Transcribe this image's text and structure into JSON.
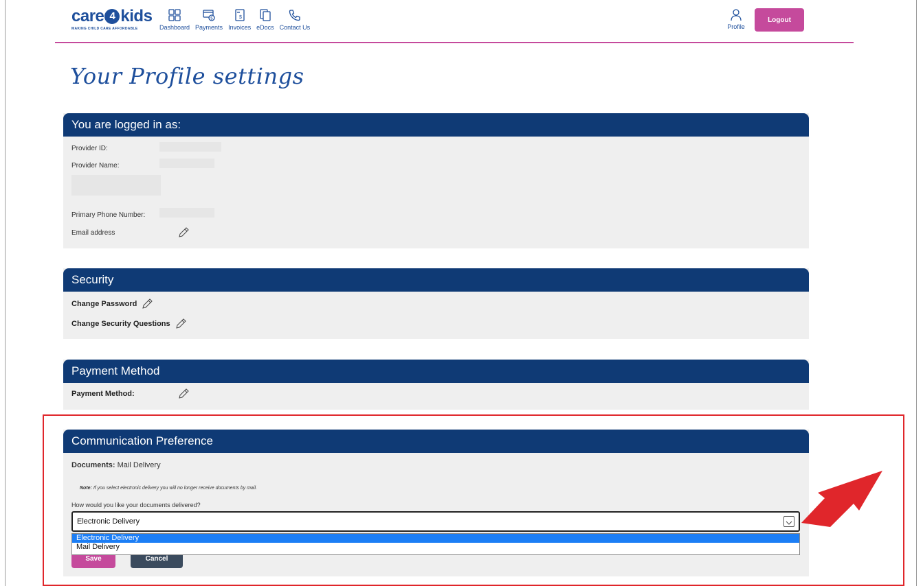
{
  "brand": {
    "name_left": "care",
    "name_mid": "4",
    "name_right": "kids",
    "tagline": "MAKING CHILD CARE AFFORDABLE",
    "primary_color": "#1e4f9c",
    "accent_color": "#c54a9c"
  },
  "nav": [
    {
      "label": "Dashboard",
      "icon": "dashboard-icon"
    },
    {
      "label": "Payments",
      "icon": "payments-icon"
    },
    {
      "label": "Invoices",
      "icon": "invoices-icon"
    },
    {
      "label": "eDocs",
      "icon": "edocs-icon"
    },
    {
      "label": "Contact Us",
      "icon": "phone-icon"
    }
  ],
  "header": {
    "profile_label": "Profile",
    "logout_label": "Logout"
  },
  "page": {
    "title": "Your Profile settings"
  },
  "logged_in": {
    "title": "You are logged in as:",
    "provider_id_label": "Provider ID:",
    "provider_name_label": "Provider Name:",
    "primary_phone_label": "Primary Phone Number:",
    "email_label": "Email address"
  },
  "security": {
    "title": "Security",
    "change_password": "Change Password",
    "change_questions": "Change Security Questions"
  },
  "payment": {
    "title": "Payment Method",
    "method_label": "Payment Method:"
  },
  "communication": {
    "title": "Communication Preference",
    "documents_label": "Documents:",
    "documents_value": "Mail Delivery",
    "note_label": "Note:",
    "note_text": "If you select electronic delivery you will no longer receive documents by mail.",
    "question": "How would you like your documents delivered?",
    "selected_value": "Electronic Delivery",
    "options": [
      "Electronic Delivery",
      "Mail Delivery"
    ],
    "save_label": "Save",
    "cancel_label": "Cancel"
  },
  "annotation": {
    "highlight_color": "#e0262b"
  }
}
